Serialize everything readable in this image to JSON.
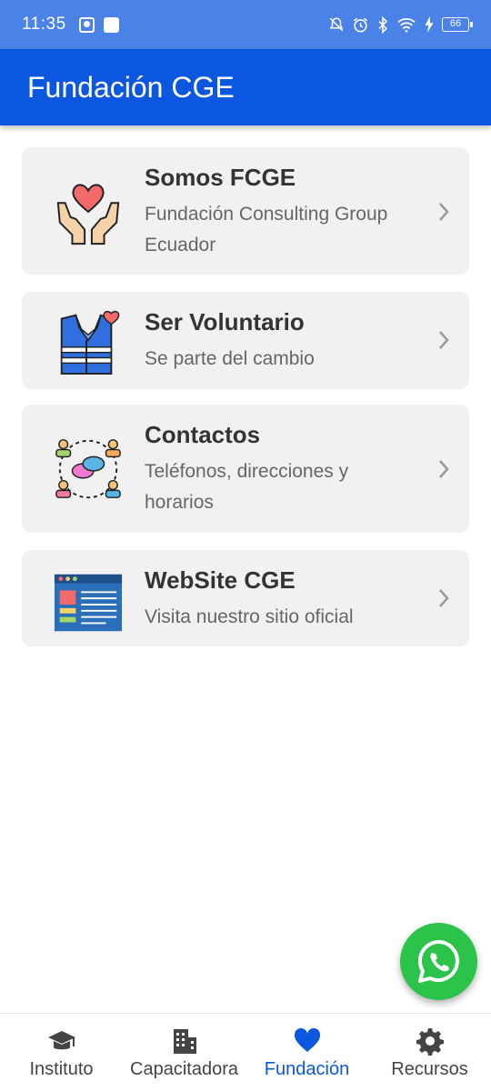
{
  "status_bar": {
    "time": "11:35",
    "battery": "66",
    "icons": [
      "photo-icon",
      "square-icon",
      "mute-icon",
      "alarm-icon",
      "bluetooth-icon",
      "wifi-icon",
      "charging-icon",
      "battery-icon"
    ]
  },
  "app_bar": {
    "title": "Fundación CGE"
  },
  "cards": [
    {
      "title": "Somos FCGE",
      "subtitle": "Fundación Consulting Group Ecuador",
      "icon": "heart-hands-icon"
    },
    {
      "title": "Ser Voluntario",
      "subtitle": "Se parte del cambio",
      "icon": "volunteer-vest-icon"
    },
    {
      "title": "Contactos",
      "subtitle": "Teléfonos, direcciones y horarios",
      "icon": "contacts-network-icon"
    },
    {
      "title": "WebSite CGE",
      "subtitle": "Visita nuestro sitio oficial",
      "icon": "website-icon"
    }
  ],
  "fab": {
    "icon": "whatsapp-icon",
    "color": "#2bc34a"
  },
  "bottom_nav": {
    "items": [
      {
        "label": "Instituto",
        "icon": "graduation-cap-icon"
      },
      {
        "label": "Capacitadora",
        "icon": "building-icon"
      },
      {
        "label": "Fundación",
        "icon": "heart-icon",
        "active": true
      },
      {
        "label": "Recursos",
        "icon": "gear-icon"
      }
    ],
    "active_color": "#0c57e0"
  },
  "colors": {
    "status_bar": "#4a82e8",
    "app_bar": "#0c57e0",
    "card_bg": "#f1f1f1"
  }
}
